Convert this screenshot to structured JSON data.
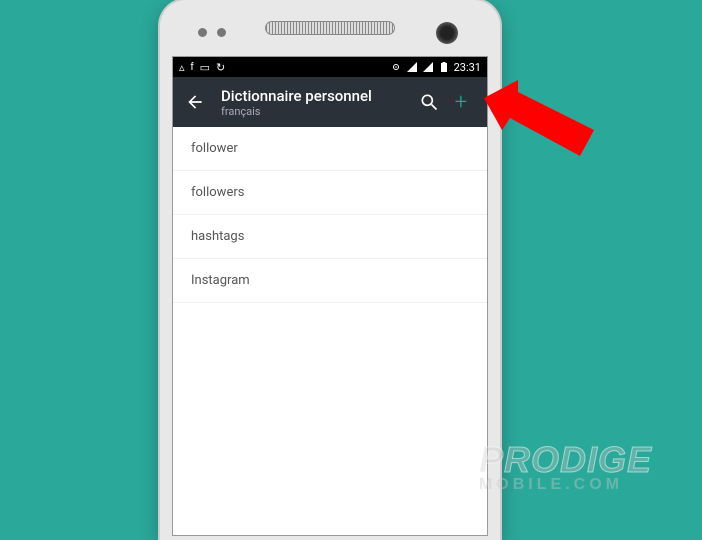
{
  "status": {
    "time": "23:31"
  },
  "appbar": {
    "title": "Dictionnaire personnel",
    "subtitle": "français"
  },
  "list": {
    "items": [
      {
        "label": "follower"
      },
      {
        "label": "followers"
      },
      {
        "label": "hashtags"
      },
      {
        "label": "Instagram"
      }
    ]
  },
  "watermark": {
    "line1": "PRODIGE",
    "line2": "MOBILE.COM"
  }
}
